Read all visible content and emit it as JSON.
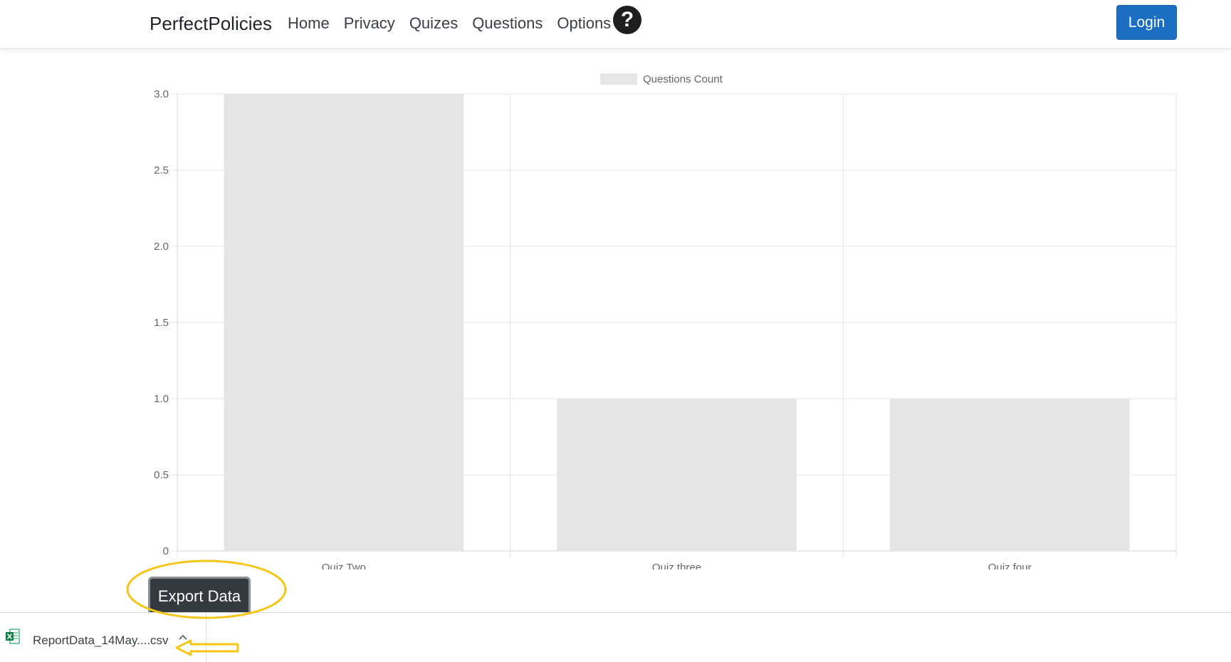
{
  "navbar": {
    "brand": "PerfectPolicies",
    "links": [
      "Home",
      "Privacy",
      "Quizes",
      "Questions",
      "Options"
    ],
    "help_icon": "question-circle-icon",
    "login_label": "Login"
  },
  "chart_data": {
    "type": "bar",
    "categories": [
      "Quiz Two",
      "Quiz three",
      "Quiz four"
    ],
    "series": [
      {
        "name": "Questions Count",
        "values": [
          3,
          1,
          1
        ]
      }
    ],
    "ylim": [
      0,
      3
    ],
    "yticks": [
      "0",
      "0.5",
      "1.0",
      "1.5",
      "2.0",
      "2.5",
      "3.0"
    ],
    "legend_position": "top",
    "grid": true,
    "bar_color": "#e5e5e5",
    "grid_color": "#e6e6e6"
  },
  "export_label": "Export Data",
  "download": {
    "file_name": "ReportData_14May....csv",
    "file_icon": "excel-file-icon"
  },
  "colors": {
    "accent": "#1b6ec2",
    "annotation": "#f5c518",
    "dark_button": "#343a40"
  }
}
